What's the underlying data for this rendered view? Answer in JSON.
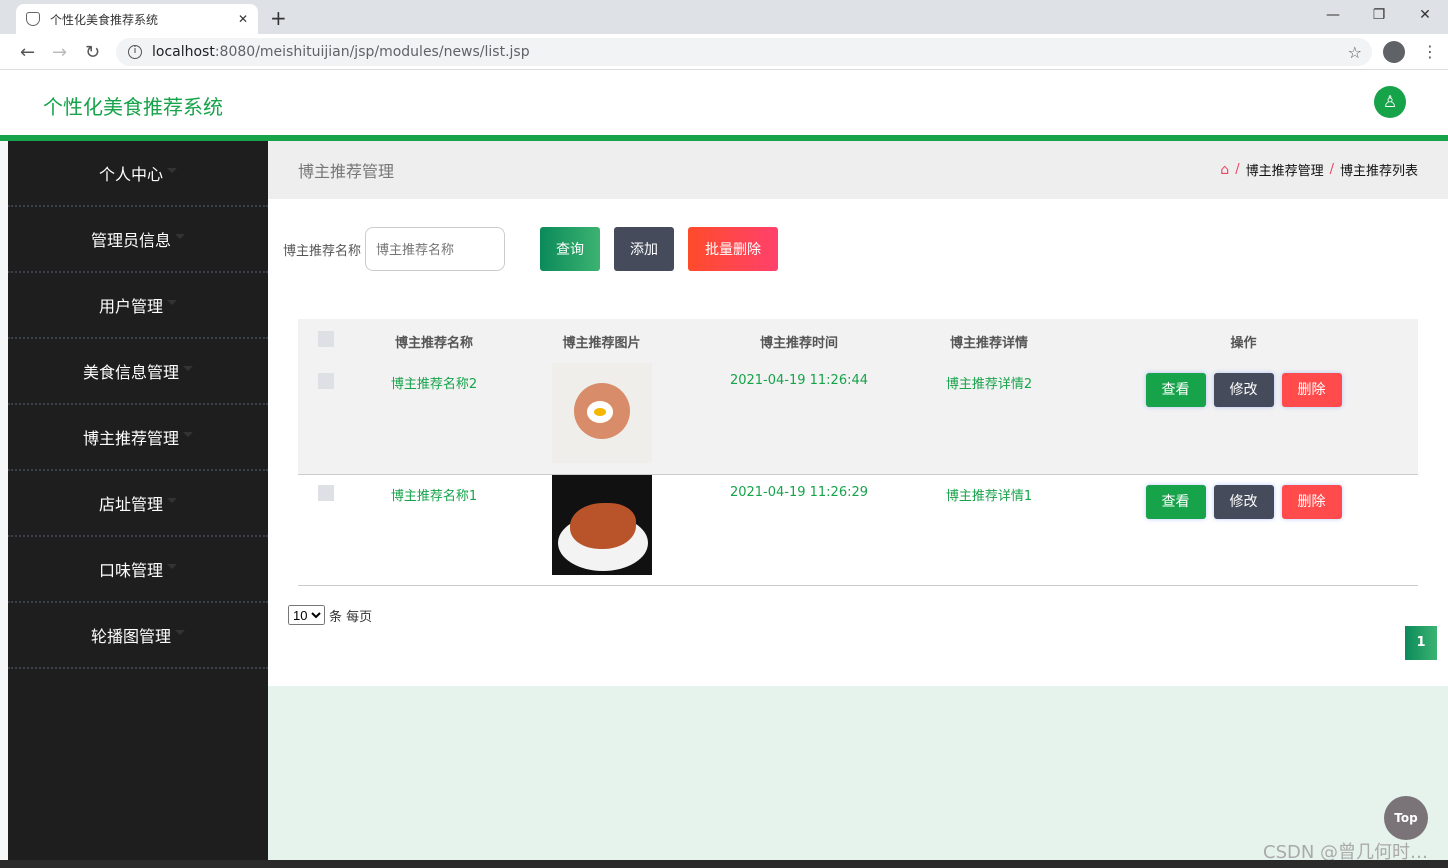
{
  "browser": {
    "tab_title": "个性化美食推荐系统",
    "url_host": "localhost",
    "url_rest": ":8080/meishituijian/jsp/modules/news/list.jsp"
  },
  "header": {
    "brand": "个性化美食推荐系统"
  },
  "sidebar": {
    "items": [
      {
        "label": "个人中心"
      },
      {
        "label": "管理员信息"
      },
      {
        "label": "用户管理"
      },
      {
        "label": "美食信息管理"
      },
      {
        "label": "博主推荐管理"
      },
      {
        "label": "店址管理"
      },
      {
        "label": "口味管理"
      },
      {
        "label": "轮播图管理"
      }
    ]
  },
  "page": {
    "title": "博主推荐管理",
    "breadcrumb": [
      "博主推荐管理",
      "博主推荐列表"
    ]
  },
  "search": {
    "label": "博主推荐名称",
    "placeholder": "博主推荐名称",
    "query": "查询",
    "add": "添加",
    "batch_delete": "批量删除"
  },
  "table": {
    "headers": [
      "博主推荐名称",
      "博主推荐图片",
      "博主推荐时间",
      "博主推荐详情",
      "操作"
    ],
    "rows": [
      {
        "name": "博主推荐名称2",
        "time": "2021-04-19 11:26:44",
        "detail": "博主推荐详情2"
      },
      {
        "name": "博主推荐名称1",
        "time": "2021-04-19 11:26:29",
        "detail": "博主推荐详情1"
      }
    ],
    "actions": {
      "view": "查看",
      "edit": "修改",
      "delete": "删除"
    }
  },
  "pager": {
    "page_size": "10",
    "suffix": "条 每页",
    "current_page": "1"
  },
  "top_button": "Top",
  "watermark": "CSDN @曾几何时…",
  "colors": {
    "accent": "#16a34a",
    "sidebar": "#1e1e1e",
    "danger": "#ff4b4b"
  }
}
